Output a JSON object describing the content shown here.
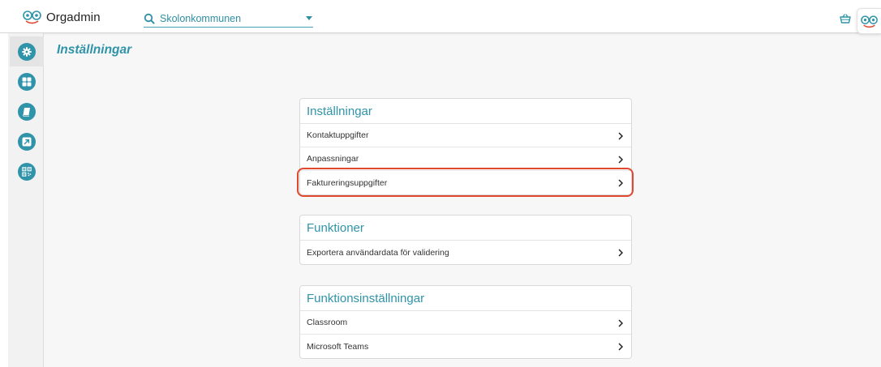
{
  "header": {
    "brand": "Orgadmin",
    "org_select": {
      "value": "Skolonkommunen"
    },
    "colors": {
      "accent": "#2f93a9",
      "logo_smile": "#e0482f"
    }
  },
  "sidebar": {
    "items": [
      {
        "name": "settings",
        "icon": "gear-icon",
        "active": true
      },
      {
        "name": "apps",
        "icon": "grid-icon",
        "active": false
      },
      {
        "name": "licenses",
        "icon": "book-icon",
        "active": false
      },
      {
        "name": "external",
        "icon": "external-link-icon",
        "active": false
      },
      {
        "name": "qr",
        "icon": "qr-code-icon",
        "active": false
      }
    ]
  },
  "main": {
    "title": "Inställningar",
    "sections": [
      {
        "title": "Inställningar",
        "rows": [
          "Kontaktuppgifter",
          "Anpassningar",
          "Faktureringsuppgifter"
        ]
      },
      {
        "title": "Funktioner",
        "rows": [
          "Exportera användardata för validering"
        ]
      },
      {
        "title": "Funktionsinställningar",
        "rows": [
          "Classroom",
          "Microsoft Teams"
        ]
      }
    ],
    "highlighted_row": "Faktureringsuppgifter",
    "highlight_color": "#e0482f"
  }
}
